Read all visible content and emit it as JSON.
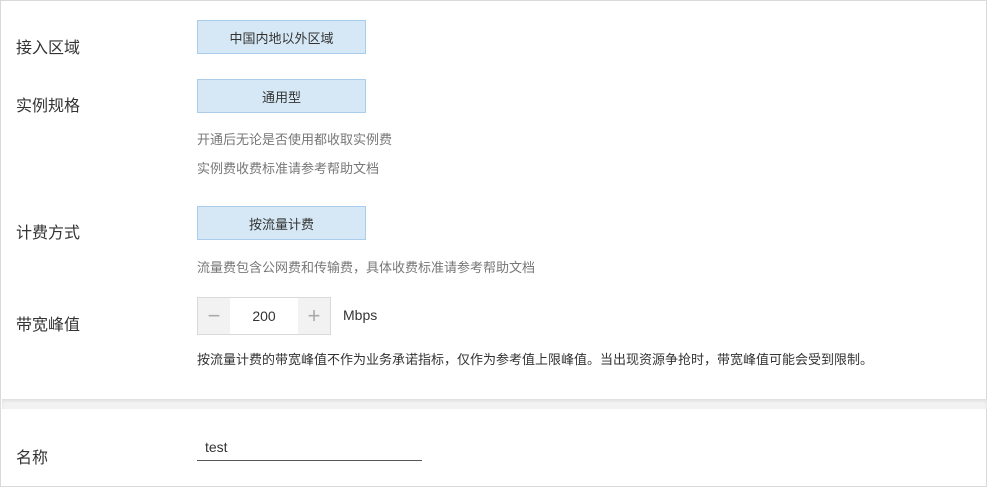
{
  "form": {
    "region": {
      "label": "接入区域",
      "option": "中国内地以外区域"
    },
    "spec": {
      "label": "实例规格",
      "option": "通用型",
      "hint1": "开通后无论是否使用都收取实例费",
      "hint2": "实例费收费标准请参考帮助文档"
    },
    "billing": {
      "label": "计费方式",
      "option": "按流量计费",
      "hint": "流量费包含公网费和传输费，具体收费标准请参考帮助文档"
    },
    "bandwidth": {
      "label": "带宽峰值",
      "minus_icon": "minus-icon",
      "plus_icon": "plus-icon",
      "value": "200",
      "unit": "Mbps",
      "note": "按流量计费的带宽峰值不作为业务承诺指标，仅作为参考值上限峰值。当出现资源争抢时，带宽峰值可能会受到限制。"
    },
    "name": {
      "label": "名称",
      "value": "test"
    }
  },
  "colors": {
    "option_bg": "#d6e8f6",
    "option_border": "#a9cdea",
    "hint_text": "#777777"
  }
}
